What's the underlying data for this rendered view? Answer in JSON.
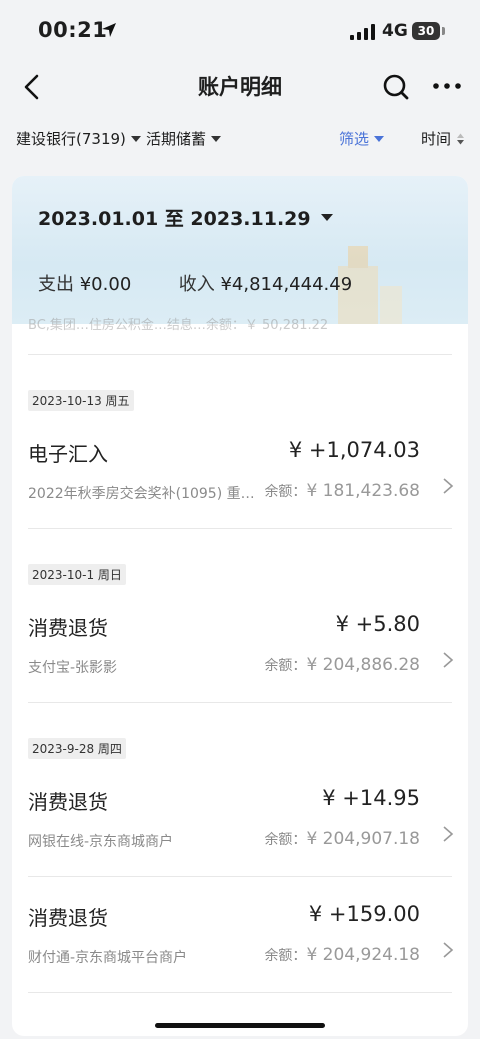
{
  "status_bar": {
    "time": "00:21",
    "network": "4G",
    "battery": "30"
  },
  "nav": {
    "title": "账户明细"
  },
  "filters": {
    "account": "建设银行(7319)",
    "deposit_type": "活期储蓄",
    "filter_label": "筛选",
    "sort_label": "时间"
  },
  "summary": {
    "date_range": "2023.01.01 至 2023.11.29",
    "expense_label": "支出",
    "expense_value": "¥0.00",
    "income_label": "收入",
    "income_value": "¥4,814,444.49"
  },
  "partial_row": "BC,集团…住房公积金…结息…余额：￥ 50,281.22",
  "transactions": [
    {
      "date": "2023-10-13 周五",
      "title": "电子汇入",
      "amount": "¥ +1,074.03",
      "desc": "2022年秋季房交会奖补(1095) 重…",
      "balance_label": "余额：",
      "balance": "¥ 181,423.68"
    },
    {
      "date": "2023-10-1 周日",
      "title": "消费退货",
      "amount": "¥ +5.80",
      "desc": "支付宝-张影影",
      "balance_label": "余额：",
      "balance": "¥ 204,886.28"
    },
    {
      "date": "2023-9-28 周四",
      "title": "消费退货",
      "amount": "¥ +14.95",
      "desc": "网银在线-京东商城商户",
      "balance_label": "余额：",
      "balance": "¥ 204,907.18"
    },
    {
      "title": "消费退货",
      "amount": "¥ +159.00",
      "desc": "财付通-京东商城平台商户",
      "balance_label": "余额：",
      "balance": "¥ 204,924.18"
    }
  ],
  "colors": {
    "accent": "#4a73d8",
    "background": "#f2f3f5"
  }
}
